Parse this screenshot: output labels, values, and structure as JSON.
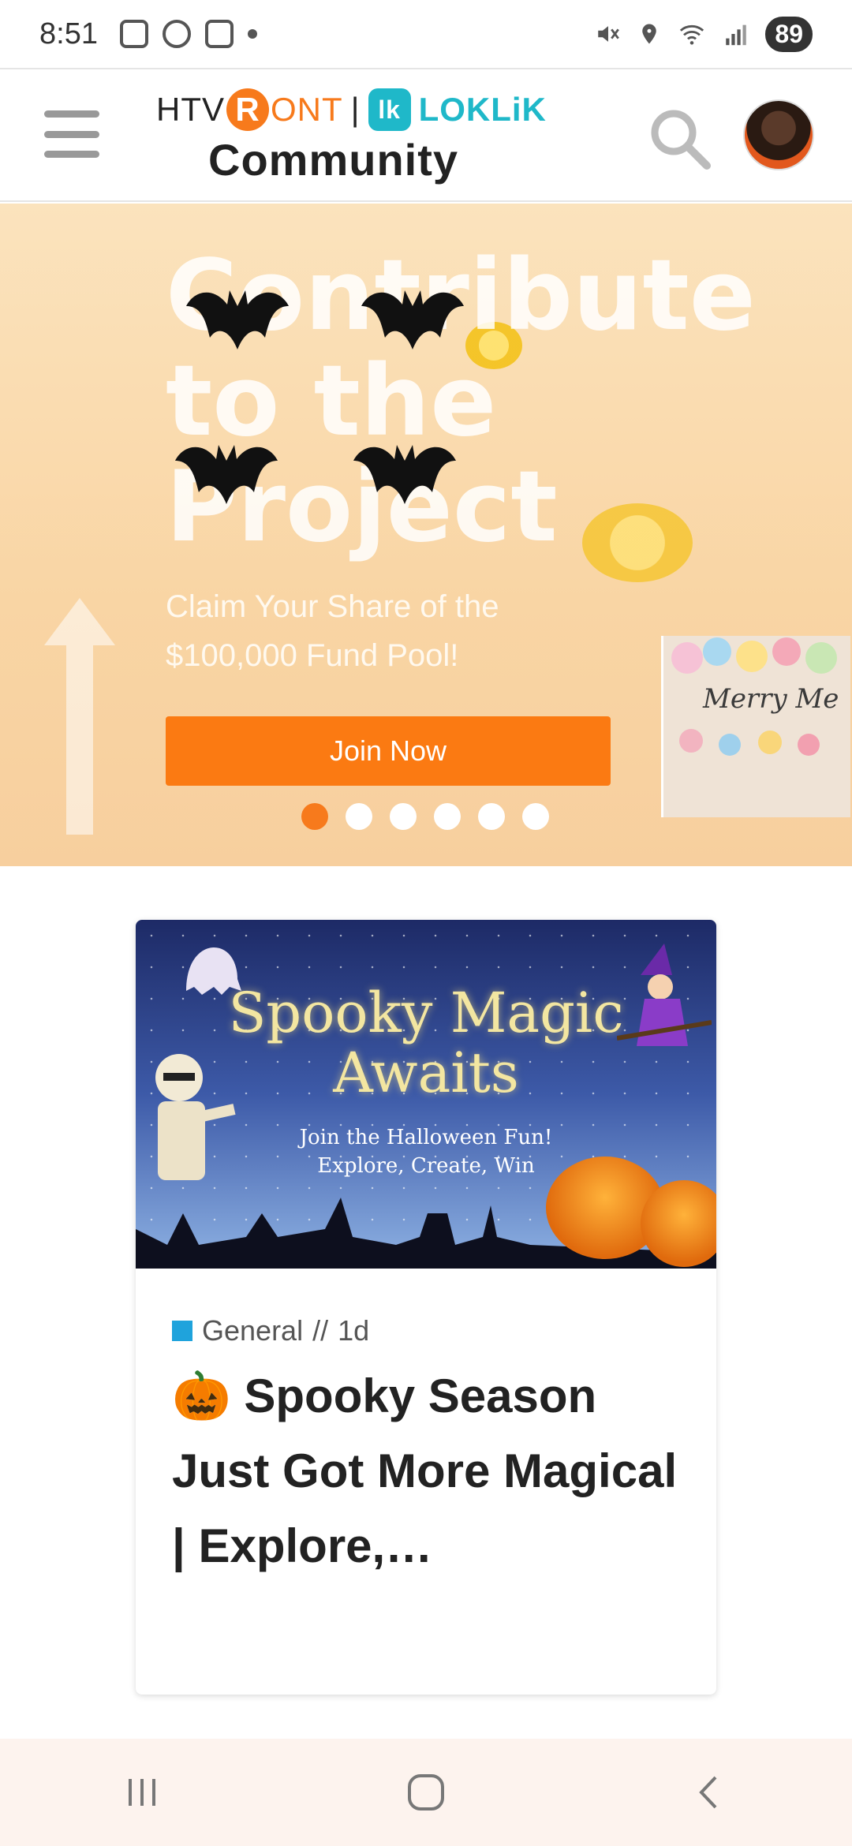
{
  "statusbar": {
    "time": "8:51",
    "battery": "89"
  },
  "header": {
    "brand_htv": "HTV",
    "brand_r": "R",
    "brand_ont": "ONT",
    "brand_sep": "|",
    "brand_lk": "lk",
    "brand_loklik": "LOKLiK",
    "brand_sub": "Community"
  },
  "banner": {
    "title": "Contribute to the Project",
    "subtitle": "Claim Your Share of the $100,000 Fund Pool!",
    "button_label": "Join Now",
    "slides_count": 6,
    "active_slide": 1,
    "side_image_text": "Merry Me"
  },
  "post": {
    "image_title": "Spooky Magic Awaits",
    "image_subtitle_1": "Join the Halloween Fun!",
    "image_subtitle_2": "Explore, Create, Win",
    "category": "General",
    "time_sep": "//",
    "time": "1d",
    "category_color": "#1fa3dc",
    "title": "🎃 Spooky Season Just Got More Magical | Explore,…"
  },
  "colors": {
    "accent_orange": "#f77a1c",
    "accent_teal": "#1fb8c9"
  }
}
